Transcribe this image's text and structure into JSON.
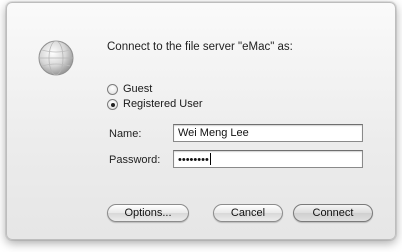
{
  "dialog": {
    "prompt": "Connect to the file server \"eMac\" as:",
    "icon": "globe-icon"
  },
  "auth": {
    "options": [
      {
        "label": "Guest",
        "selected": false
      },
      {
        "label": "Registered User",
        "selected": true
      }
    ]
  },
  "form": {
    "name_label": "Name:",
    "name_value": "Wei Meng Lee",
    "password_label": "Password:",
    "password_value": "••••••••"
  },
  "buttons": {
    "options": "Options...",
    "cancel": "Cancel",
    "connect": "Connect"
  }
}
